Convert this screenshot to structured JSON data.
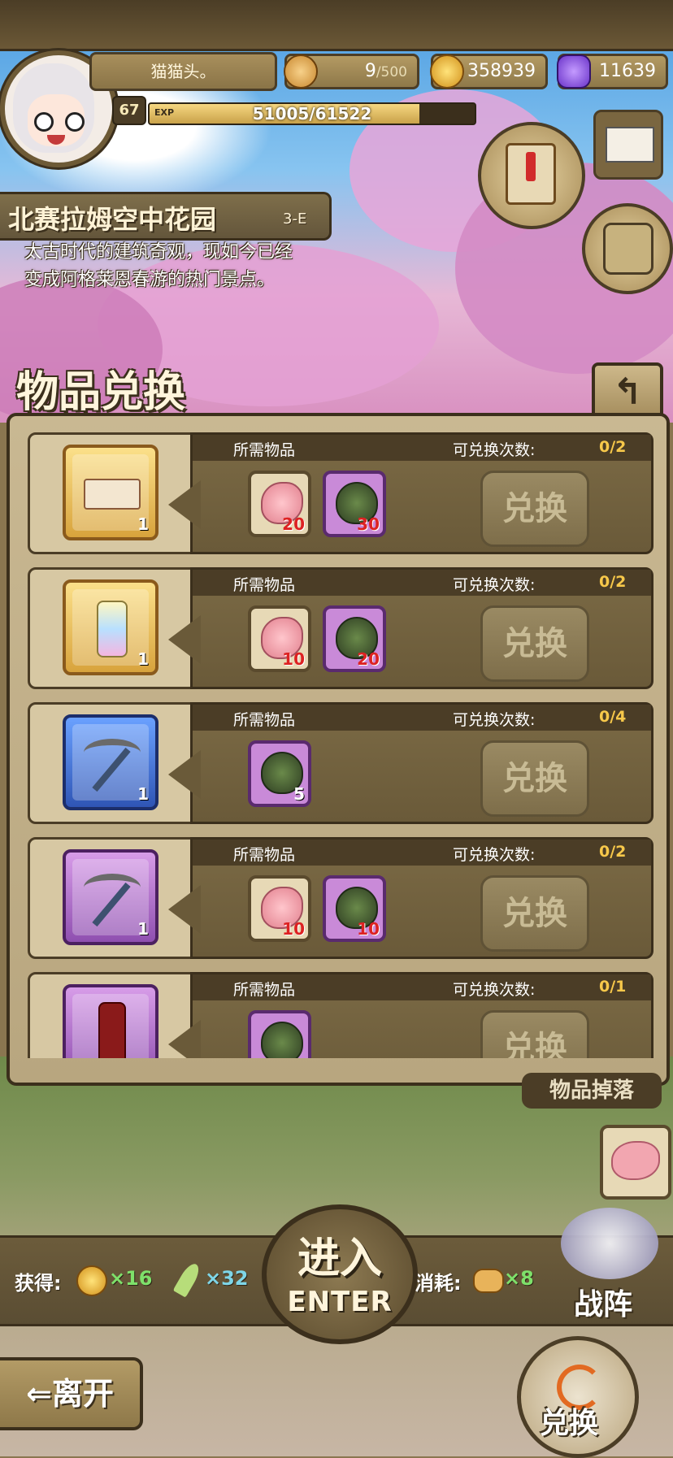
{
  "header": {
    "player_name": "猫猫头。",
    "level": "67",
    "exp_tag": "EXP",
    "exp_text": "51005/61522",
    "exp_fraction": 0.829,
    "stamina": "9",
    "stamina_max": "/500",
    "gold": "358939",
    "gems": "11639"
  },
  "location": {
    "name": "北赛拉姆空中花园",
    "code": "3-E",
    "desc_line1": "太古时代的建筑奇观，现如今已经",
    "desc_line2": "变成阿格莱恩春游的热门景点。"
  },
  "exchange": {
    "title": "物品兑换",
    "back_icon": "↰",
    "rows": [
      {
        "reward_icon": "ticket-icon",
        "reward_rarity": "gold",
        "reward_qty": "1",
        "req_label": "所需物品",
        "count_label": "可兑换次数:",
        "count": "0/2",
        "costs": [
          {
            "icon": "meat-icon",
            "qty": "20"
          },
          {
            "icon": "seed-icon",
            "qty": "30"
          }
        ],
        "button": "兑换"
      },
      {
        "reward_icon": "lantern-icon",
        "reward_rarity": "gold",
        "reward_qty": "1",
        "req_label": "所需物品",
        "count_label": "可兑换次数:",
        "count": "0/2",
        "costs": [
          {
            "icon": "meat-icon",
            "qty": "10"
          },
          {
            "icon": "seed-icon",
            "qty": "20"
          }
        ],
        "button": "兑换"
      },
      {
        "reward_icon": "pickaxe-icon",
        "reward_rarity": "blue",
        "reward_qty": "1",
        "req_label": "所需物品",
        "count_label": "可兑换次数:",
        "count": "0/4",
        "costs": [
          {
            "icon": "seed-icon",
            "qty": "5"
          }
        ],
        "button": "兑换"
      },
      {
        "reward_icon": "pickaxe-icon",
        "reward_rarity": "purple",
        "reward_qty": "1",
        "req_label": "所需物品",
        "count_label": "可兑换次数:",
        "count": "0/2",
        "costs": [
          {
            "icon": "meat-icon",
            "qty": "10"
          },
          {
            "icon": "seed-icon",
            "qty": "10"
          }
        ],
        "button": "兑换"
      },
      {
        "reward_icon": "cola-icon",
        "reward_rarity": "purple",
        "reward_qty": "",
        "req_label": "所需物品",
        "count_label": "可兑换次数:",
        "count": "0/1",
        "costs": [
          {
            "icon": "seed-icon",
            "qty": ""
          }
        ],
        "button": "兑换"
      }
    ]
  },
  "drops": {
    "label": "物品掉落"
  },
  "bottom": {
    "gain_label": "获得:",
    "gain_gold": "×16",
    "gain_feather": "×32",
    "cost_label": "消耗:",
    "cost_bread": "×8",
    "enter_cn": "进入",
    "enter_en": "ENTER",
    "formation": "战阵",
    "leave": "离开",
    "leave_arrow": "⇐",
    "exchange": "兑换"
  },
  "colors": {
    "wood_dark": "#3b2f1c",
    "wood_mid": "#7b6a45",
    "accent_yellow": "#f7c84a",
    "cost_red": "#dd2222",
    "gain_green": "#7ee06a"
  }
}
